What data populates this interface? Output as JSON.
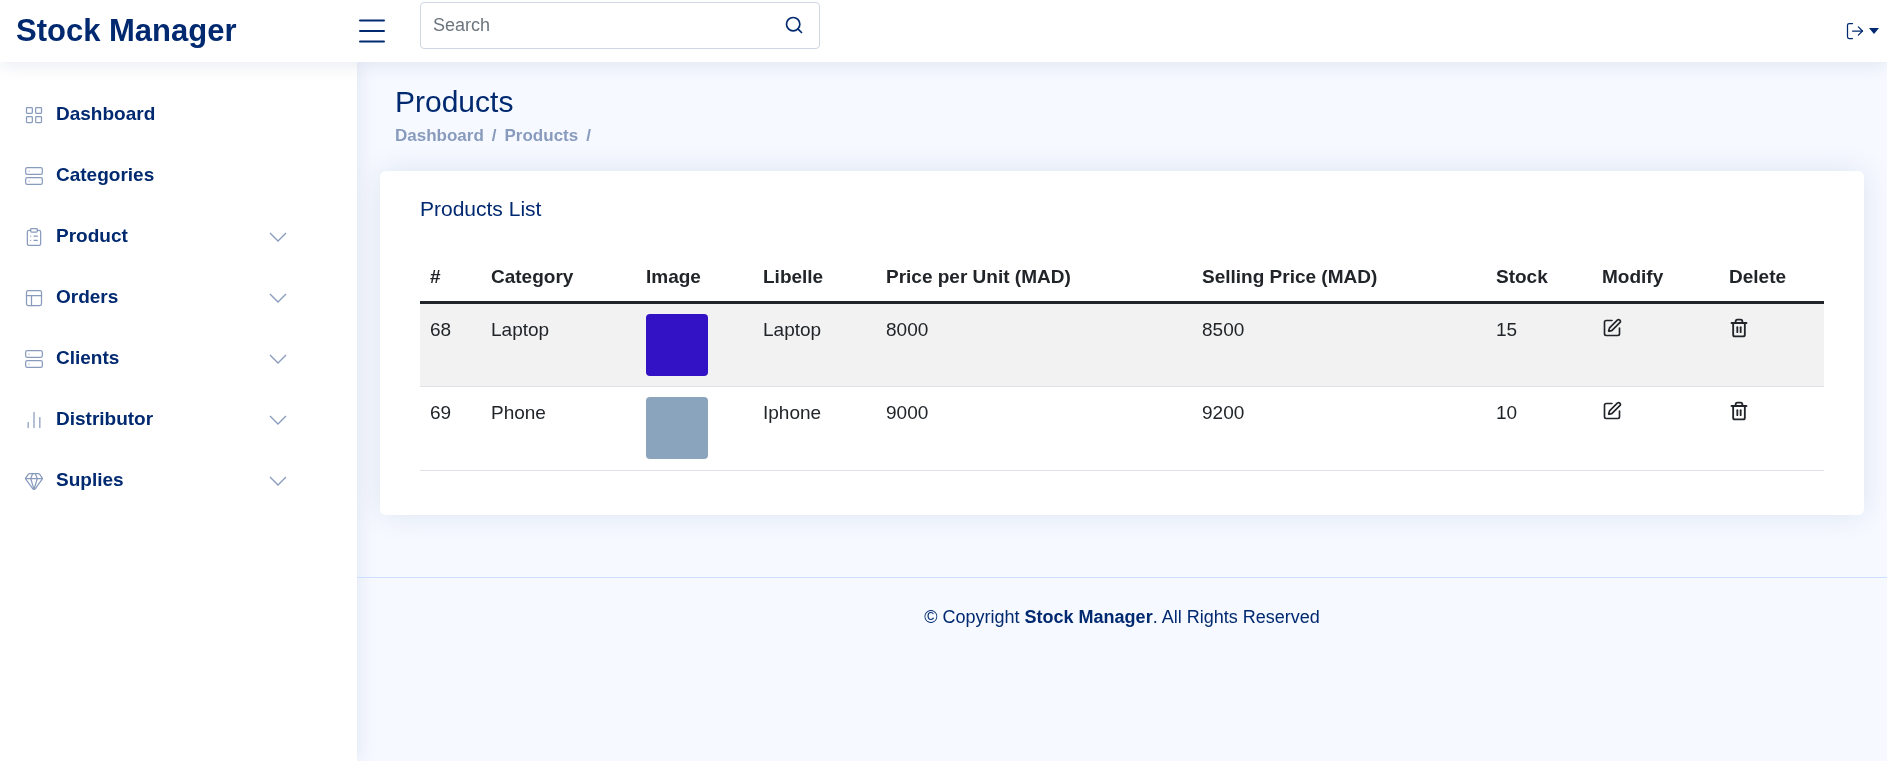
{
  "header": {
    "brand": "Stock Manager",
    "search": {
      "placeholder": "Search"
    }
  },
  "sidebar": {
    "items": [
      {
        "label": "Dashboard",
        "kind": "link"
      },
      {
        "label": "Categories",
        "kind": "link"
      },
      {
        "label": "Product",
        "kind": "dropdown"
      },
      {
        "label": "Orders",
        "kind": "dropdown"
      },
      {
        "label": "Clients",
        "kind": "dropdown"
      },
      {
        "label": "Distributor",
        "kind": "dropdown"
      },
      {
        "label": "Suplies",
        "kind": "dropdown"
      }
    ]
  },
  "page": {
    "title": "Products",
    "breadcrumb": [
      {
        "label": "Dashboard",
        "separator": "/"
      },
      {
        "label": "Products",
        "separator": "/"
      }
    ]
  },
  "card": {
    "title": "Products List",
    "table": {
      "columns": [
        "#",
        "Category",
        "Image",
        "Libelle",
        "Price per Unit (MAD)",
        "Selling Price (MAD)",
        "Stock",
        "Modify",
        "Delete"
      ],
      "rows": [
        {
          "id": "68",
          "category": "Laptop",
          "libelle": "Laptop",
          "price": "8000",
          "selling": "8500",
          "stock": "15"
        },
        {
          "id": "69",
          "category": "Phone",
          "libelle": "Iphone",
          "price": "9000",
          "selling": "9200",
          "stock": "10"
        }
      ]
    }
  },
  "footer": {
    "text": "© Copyright **Stock Manager**. All Rights Reserved"
  }
}
